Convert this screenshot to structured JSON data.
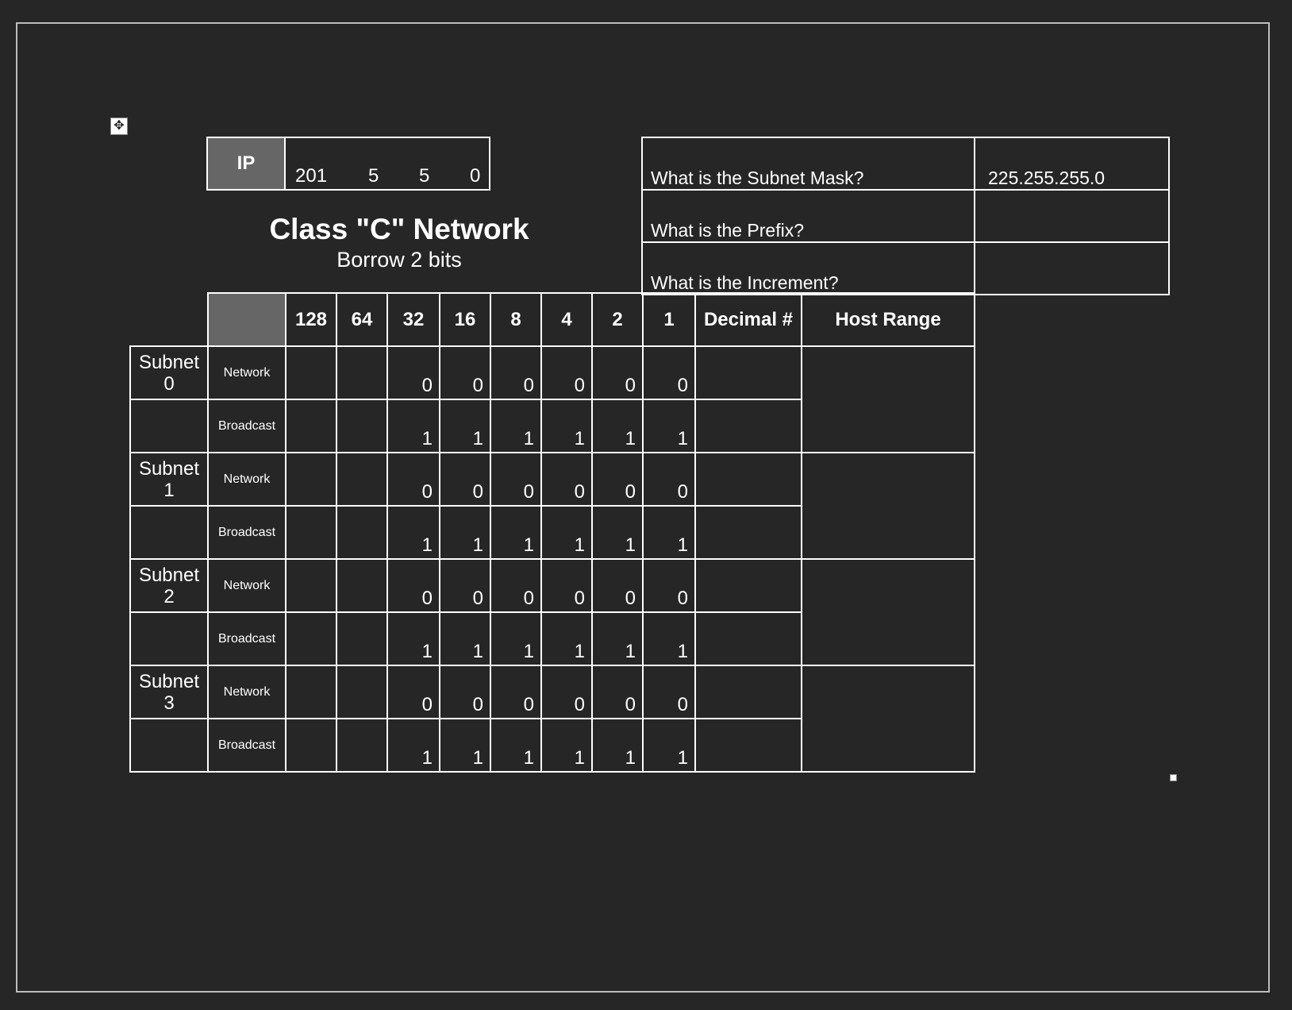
{
  "ip": {
    "label": "IP",
    "octets": [
      "201",
      "5",
      "5",
      "0"
    ]
  },
  "title": "Class \"C\" Network",
  "subtitle": "Borrow 2 bits",
  "questions": [
    {
      "question": "What is the Subnet Mask?",
      "answer": "225.255.255.0"
    },
    {
      "question": "What is the Prefix?",
      "answer": ""
    },
    {
      "question": "What is the Increment?",
      "answer": ""
    }
  ],
  "table": {
    "bit_headers": [
      "128",
      "64",
      "32",
      "16",
      "8",
      "4",
      "2",
      "1"
    ],
    "decimal_header": "Decimal #",
    "host_range_header": "Host Range",
    "subnets": [
      {
        "label_line1": "Subnet",
        "label_line2": "0",
        "network": {
          "label": "Network",
          "bits": [
            "",
            "",
            "0",
            "0",
            "0",
            "0",
            "0",
            "0"
          ]
        },
        "broadcast": {
          "label": "Broadcast",
          "bits": [
            "",
            "",
            "1",
            "1",
            "1",
            "1",
            "1",
            "1"
          ]
        }
      },
      {
        "label_line1": "Subnet",
        "label_line2": "1",
        "network": {
          "label": "Network",
          "bits": [
            "",
            "",
            "0",
            "0",
            "0",
            "0",
            "0",
            "0"
          ]
        },
        "broadcast": {
          "label": "Broadcast",
          "bits": [
            "",
            "",
            "1",
            "1",
            "1",
            "1",
            "1",
            "1"
          ]
        }
      },
      {
        "label_line1": "Subnet",
        "label_line2": "2",
        "network": {
          "label": "Network",
          "bits": [
            "",
            "",
            "0",
            "0",
            "0",
            "0",
            "0",
            "0"
          ]
        },
        "broadcast": {
          "label": "Broadcast",
          "bits": [
            "",
            "",
            "1",
            "1",
            "1",
            "1",
            "1",
            "1"
          ]
        }
      },
      {
        "label_line1": "Subnet",
        "label_line2": "3",
        "network": {
          "label": "Network",
          "bits": [
            "",
            "",
            "0",
            "0",
            "0",
            "0",
            "0",
            "0"
          ]
        },
        "broadcast": {
          "label": "Broadcast",
          "bits": [
            "",
            "",
            "1",
            "1",
            "1",
            "1",
            "1",
            "1"
          ]
        }
      }
    ]
  },
  "icons": {
    "move_handle": "move-icon",
    "resize_handle": "resize-handle-icon"
  }
}
